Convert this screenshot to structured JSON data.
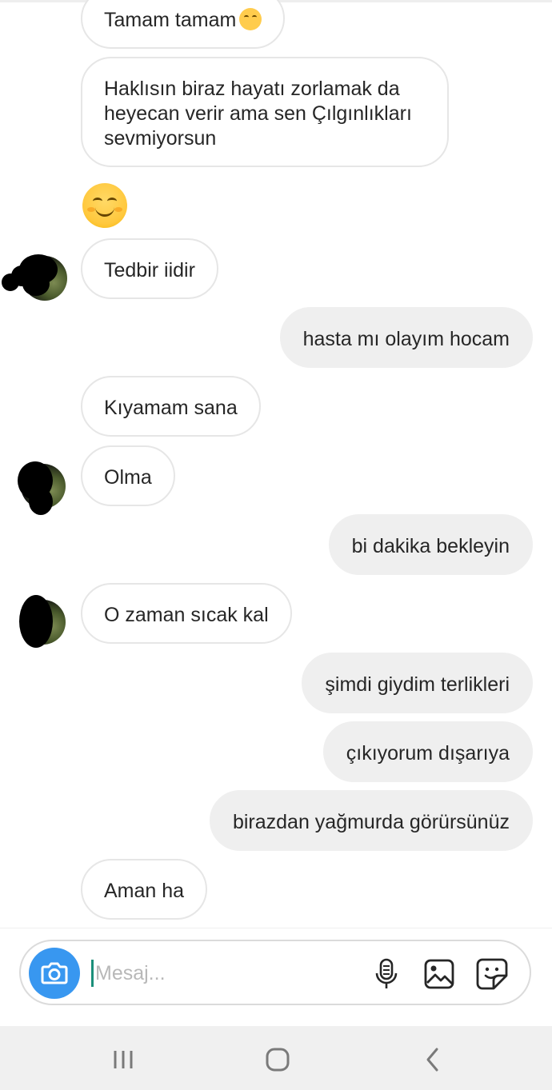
{
  "messages": [
    {
      "id": "m1",
      "side": "in",
      "text": "Tamam tamam",
      "emoji": "smiling-face-emoji"
    },
    {
      "id": "m2",
      "side": "in",
      "text": "Haklısın biraz hayatı zorlamak da heyecan verir ama sen Çılgınlıkları sevmiyorsun"
    },
    {
      "id": "m3",
      "side": "in",
      "emoji": "smiling-face-emoji"
    },
    {
      "id": "m4",
      "side": "in",
      "text": "Tedbir iidir"
    },
    {
      "id": "m5",
      "side": "out",
      "text": "hasta mı olayım hocam"
    },
    {
      "id": "m6",
      "side": "in",
      "text": "Kıyamam sana"
    },
    {
      "id": "m7",
      "side": "in",
      "text": "Olma"
    },
    {
      "id": "m8",
      "side": "out",
      "text": "bi dakika bekleyin"
    },
    {
      "id": "m9",
      "side": "in",
      "text": "O zaman sıcak kal"
    },
    {
      "id": "m10",
      "side": "out",
      "text": "şimdi giydim terlikleri"
    },
    {
      "id": "m11",
      "side": "out",
      "text": "çıkıyorum dışarıya"
    },
    {
      "id": "m12",
      "side": "out",
      "text": "birazdan yağmurda görürsünüz"
    },
    {
      "id": "m13",
      "side": "in",
      "text": "Aman ha"
    }
  ],
  "composer": {
    "placeholder": "Mesaj...",
    "icons": [
      "camera-icon",
      "microphone-icon",
      "gallery-icon",
      "sticker-icon"
    ],
    "accent": "#3897f0"
  },
  "navbar": {
    "icons": [
      "recent-apps-icon",
      "home-icon",
      "back-icon"
    ]
  },
  "colors": {
    "incoming_bubble": "#ffffff",
    "incoming_border": "#e6e6e6",
    "outgoing_bubble": "#efefef",
    "text": "#262626"
  }
}
